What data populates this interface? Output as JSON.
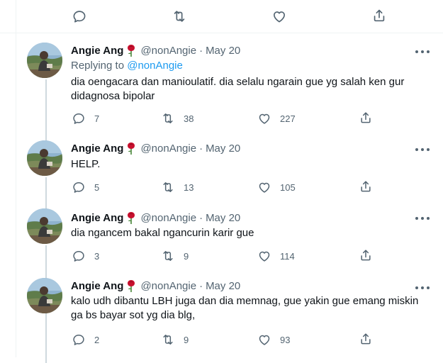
{
  "top_actions": {
    "reply_count": "",
    "retweet_count": "",
    "like_count": ""
  },
  "author": {
    "name": "Angie Ang",
    "handle": "@nonAngie",
    "separator": "·"
  },
  "tweets": [
    {
      "date": "May 20",
      "replying_label": "Replying to",
      "replying_handle": "@nonAngie",
      "text": "dia oengacara dan manioulatif. dia selalu ngarain gue yg salah ken gur didagnosa bipolar",
      "replies": "7",
      "retweets": "38",
      "likes": "227"
    },
    {
      "date": "May 20",
      "text": "HELP.",
      "replies": "5",
      "retweets": "13",
      "likes": "105"
    },
    {
      "date": "May 20",
      "text": "dia ngancem bakal ngancurin karir gue",
      "replies": "3",
      "retweets": "9",
      "likes": "114"
    },
    {
      "date": "May 20",
      "text": "kalo udh dibantu LBH juga dan dia memnag, gue yakin gue emang miskin ga bs bayar sot yg dia blg,",
      "replies": "2",
      "retweets": "9",
      "likes": "93"
    }
  ],
  "colors": {
    "text_primary": "#0f1419",
    "text_secondary": "#536471",
    "link": "#1d9bf0",
    "thread_line": "#cfd9de",
    "rose": "#c8102e"
  },
  "icons": [
    "reply-icon",
    "retweet-icon",
    "like-icon",
    "share-icon",
    "more-icon",
    "rose-emoji"
  ]
}
